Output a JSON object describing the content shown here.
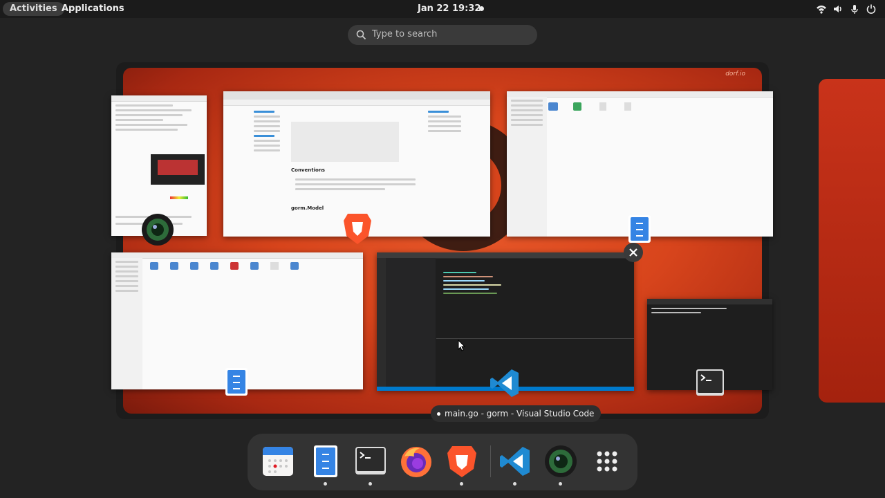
{
  "topbar": {
    "activities": "Activities",
    "applications": "Applications",
    "clock": "Jan 22  19:32"
  },
  "search": {
    "placeholder": "Type to search"
  },
  "workspace": {
    "watermark": "dorf.io"
  },
  "tooltip": {
    "text": "main.go - gorm - Visual Studio Code"
  },
  "windows": [
    {
      "name": "camera-settings-window",
      "app_icon": "camera-icon"
    },
    {
      "name": "brave-browser-window",
      "app_icon": "brave-icon",
      "heading": "Conventions",
      "heading2": "gorm.Model"
    },
    {
      "name": "files-window-1",
      "app_icon": "files-icon"
    },
    {
      "name": "files-window-2",
      "app_icon": "files-icon"
    },
    {
      "name": "vscode-window",
      "app_icon": "vscode-icon"
    },
    {
      "name": "terminal-window",
      "app_icon": "terminal-icon"
    }
  ],
  "dock": [
    {
      "name": "calendar",
      "icon": "calendar-icon",
      "running": false
    },
    {
      "name": "files",
      "icon": "files-icon",
      "running": true
    },
    {
      "name": "terminal",
      "icon": "terminal-icon",
      "running": true
    },
    {
      "name": "firefox",
      "icon": "firefox-icon",
      "running": false
    },
    {
      "name": "brave",
      "icon": "brave-icon",
      "running": true
    },
    {
      "name": "vscode",
      "icon": "vscode-icon",
      "running": true
    },
    {
      "name": "camera",
      "icon": "camera-icon",
      "running": true
    },
    {
      "name": "show-apps",
      "icon": "app-grid-icon",
      "running": false
    }
  ],
  "colors": {
    "accent": "#3584e4",
    "workspace": "#d8451c",
    "dock": "#333333"
  }
}
